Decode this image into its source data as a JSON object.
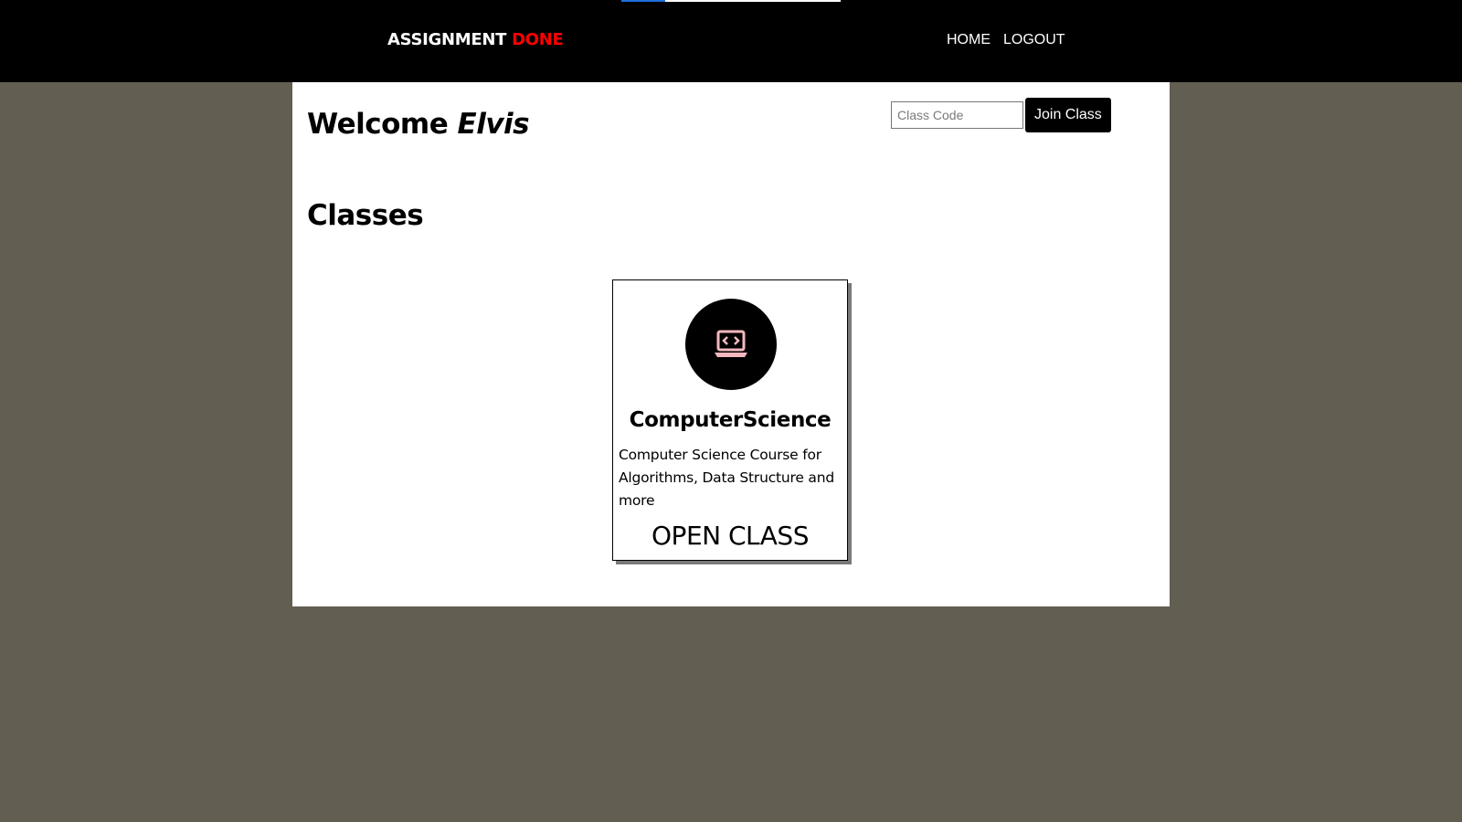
{
  "colors": {
    "page_background": "#625e52",
    "navbar_background": "#000000",
    "brand_accent": "#ff0000",
    "icon_color": "#f4b8bf",
    "loading_bar": "#1e6fd9"
  },
  "loading": {
    "progress": 0.2
  },
  "navbar": {
    "brand": {
      "primary": "ASSIGNMENT",
      "accent": "DONE"
    },
    "links": [
      {
        "label": "HOME"
      },
      {
        "label": "LOGOUT"
      }
    ]
  },
  "main": {
    "welcome": {
      "prefix": "Welcome",
      "name": "Elvis"
    },
    "join": {
      "input_value": "",
      "input_placeholder": "Class Code",
      "button_label": "Join Class"
    },
    "classes_heading": "Classes",
    "classes": [
      {
        "icon": "laptop-code-icon",
        "title": "ComputerScience",
        "description": "Computer Science Course for Algorithms, Data Structure and more",
        "action_label": "OPEN CLASS"
      }
    ]
  }
}
